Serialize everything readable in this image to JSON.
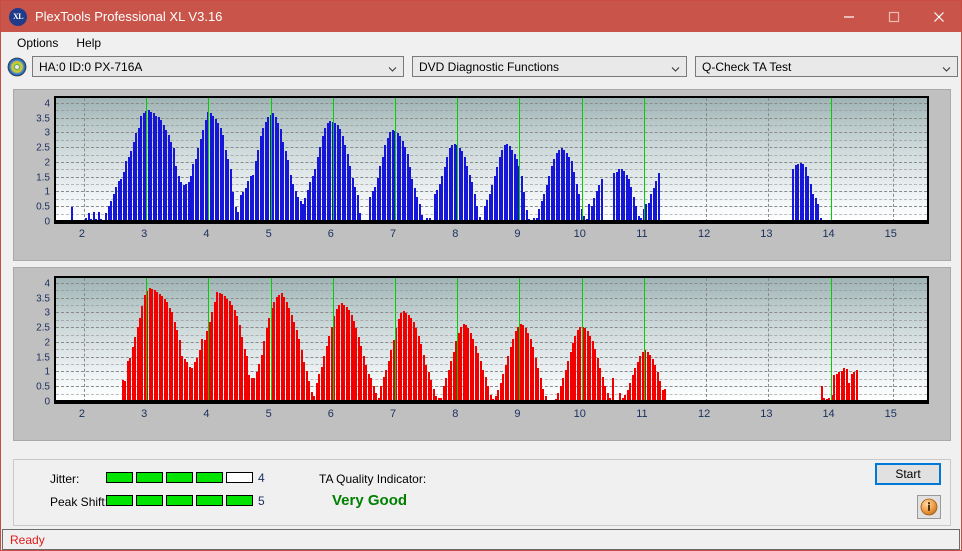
{
  "window": {
    "title": "PlexTools Professional XL V3.16",
    "icon": "app-disc-icon",
    "icon_text": "XL",
    "minimize_label": "Minimize",
    "maximize_label": "Maximize",
    "close_label": "Close",
    "titlebar_color": "#c9554a"
  },
  "menu": {
    "items": [
      {
        "label": "Options"
      },
      {
        "label": "Help"
      }
    ]
  },
  "toolbar": {
    "disc_icon": "optical-disc-icon",
    "drive_select": {
      "value": "HA:0 ID:0  PX-716A"
    },
    "function_select": {
      "value": "DVD Diagnostic Functions"
    },
    "test_select": {
      "value": "Q-Check TA Test"
    }
  },
  "charts": {
    "y_ticks": [
      "4",
      "3.5",
      "3",
      "2.5",
      "2",
      "1.5",
      "1",
      "0.5",
      "0"
    ],
    "x_ticks": [
      "2",
      "3",
      "4",
      "5",
      "6",
      "7",
      "8",
      "9",
      "10",
      "11",
      "12",
      "13",
      "14",
      "15"
    ],
    "marker_color": "#00d000",
    "markers": [
      3,
      4,
      5,
      6,
      7,
      8,
      9,
      10,
      11,
      14
    ]
  },
  "chart_data": [
    {
      "type": "bar",
      "name": "jitter-histogram-top",
      "title": "",
      "xlabel": "",
      "ylabel": "",
      "color": "#1616d8",
      "xlim": [
        1.55,
        15.55
      ],
      "ylim": [
        0,
        4.2
      ],
      "xticks": [
        2,
        3,
        4,
        5,
        6,
        7,
        8,
        9,
        10,
        11,
        12,
        13,
        14,
        15
      ],
      "yticks": [
        0,
        0.5,
        1,
        1.5,
        2,
        2.5,
        3,
        3.5,
        4
      ],
      "grid": true,
      "x": [
        1.8,
        1.84,
        1.88,
        1.92,
        1.96,
        2.0,
        2.04,
        2.08,
        2.12,
        2.16,
        2.2,
        2.24,
        2.28,
        2.32,
        2.36,
        2.4,
        2.44,
        2.48,
        2.52,
        2.56,
        2.6,
        2.64,
        2.68,
        2.72,
        2.76,
        2.8,
        2.84,
        2.88,
        2.92,
        2.96,
        3.0,
        3.04,
        3.08,
        3.12,
        3.16,
        3.2,
        3.24,
        3.28,
        3.32,
        3.36,
        3.4,
        3.44,
        3.48,
        3.52,
        3.56,
        3.6,
        3.64,
        3.68,
        3.72,
        3.76,
        3.8,
        3.84,
        3.88,
        3.92,
        3.96,
        4.0,
        4.04,
        4.08,
        4.12,
        4.16,
        4.2,
        4.24,
        4.28,
        4.32,
        4.36,
        4.4,
        4.44,
        4.48,
        4.52,
        4.56,
        4.6,
        4.64,
        4.68,
        4.72,
        4.76,
        4.8,
        4.84,
        4.88,
        4.92,
        4.96,
        5.0,
        5.04,
        5.08,
        5.12,
        5.16,
        5.2,
        5.24,
        5.28,
        5.32,
        5.36,
        5.4,
        5.44,
        5.48,
        5.52,
        5.56,
        5.6,
        5.64,
        5.68,
        5.72,
        5.76,
        5.8,
        5.84,
        5.88,
        5.92,
        5.96,
        6.0,
        6.04,
        6.08,
        6.12,
        6.16,
        6.2,
        6.24,
        6.28,
        6.32,
        6.36,
        6.4,
        6.44,
        6.48,
        6.52,
        6.56,
        6.6,
        6.64,
        6.68,
        6.72,
        6.76,
        6.8,
        6.84,
        6.88,
        6.92,
        6.96,
        7.0,
        7.04,
        7.08,
        7.12,
        7.16,
        7.2,
        7.24,
        7.28,
        7.32,
        7.36,
        7.4,
        7.44,
        7.48,
        7.52,
        7.56,
        7.6,
        7.64,
        7.68,
        7.72,
        7.76,
        7.8,
        7.84,
        7.88,
        7.92,
        7.96,
        8.0,
        8.04,
        8.08,
        8.12,
        8.16,
        8.2,
        8.24,
        8.28,
        8.32,
        8.36,
        8.4,
        8.44,
        8.48,
        8.52,
        8.56,
        8.6,
        8.64,
        8.68,
        8.72,
        8.76,
        8.8,
        8.84,
        8.88,
        8.92,
        8.96,
        9.0,
        9.04,
        9.08,
        9.12,
        9.16,
        9.2,
        9.24,
        9.28,
        9.32,
        9.36,
        9.4,
        9.44,
        9.48,
        9.52,
        9.56,
        9.6,
        9.64,
        9.68,
        9.72,
        9.76,
        9.8,
        9.84,
        9.88,
        9.92,
        9.96,
        10.0,
        10.04,
        10.08,
        10.12,
        10.16,
        10.2,
        10.24,
        10.28,
        10.32,
        10.52,
        10.56,
        10.6,
        10.64,
        10.68,
        10.72,
        10.76,
        10.8,
        10.84,
        10.88,
        10.92,
        10.96,
        11.0,
        11.04,
        11.08,
        11.12,
        11.16,
        11.2,
        11.24,
        13.4,
        13.44,
        13.48,
        13.52,
        13.56,
        13.6,
        13.64,
        13.68,
        13.72,
        13.76,
        13.8,
        13.84,
        13.88,
        13.92,
        13.96,
        14.0,
        14.04,
        14.08,
        14.12,
        14.16,
        14.2,
        14.24
      ],
      "values": [
        0.5,
        0.02,
        0.02,
        0.02,
        0.02,
        0.02,
        0.12,
        0.3,
        0.1,
        0.33,
        0.1,
        0.33,
        0.1,
        0.04,
        0.3,
        0.55,
        0.7,
        0.95,
        1.2,
        1.4,
        1.45,
        1.7,
        2.05,
        2.2,
        2.4,
        2.7,
        3.0,
        3.2,
        3.6,
        3.7,
        3.75,
        3.78,
        3.72,
        3.68,
        3.6,
        3.55,
        3.45,
        3.3,
        3.1,
        2.95,
        2.7,
        2.5,
        1.9,
        1.55,
        1.35,
        1.25,
        1.3,
        1.35,
        1.55,
        1.95,
        2.15,
        2.5,
        2.8,
        3.1,
        3.45,
        3.72,
        3.68,
        3.6,
        3.5,
        3.35,
        3.18,
        2.95,
        2.45,
        2.15,
        1.8,
        1.0,
        0.52,
        0.35,
        0.9,
        1.0,
        1.15,
        1.4,
        1.55,
        1.6,
        2.05,
        2.45,
        2.9,
        3.2,
        3.4,
        3.55,
        3.62,
        3.68,
        3.55,
        3.35,
        3.15,
        2.7,
        2.4,
        2.1,
        1.6,
        1.3,
        1.05,
        0.85,
        0.72,
        0.6,
        0.8,
        1.1,
        1.35,
        1.55,
        1.8,
        2.2,
        2.55,
        2.9,
        3.2,
        3.35,
        3.42,
        3.4,
        3.35,
        3.28,
        3.15,
        2.9,
        2.6,
        2.3,
        1.9,
        1.5,
        1.2,
        0.9,
        0.3,
        0.05,
        0.02,
        0.02,
        0.85,
        1.05,
        1.2,
        1.5,
        1.9,
        2.2,
        2.6,
        2.85,
        3.05,
        3.12,
        3.08,
        3.0,
        2.9,
        2.75,
        2.55,
        2.3,
        1.85,
        1.45,
        1.15,
        0.85,
        0.6,
        0.25,
        0.08,
        0.15,
        0.12,
        0.05,
        0.95,
        1.1,
        1.3,
        1.55,
        1.85,
        2.2,
        2.5,
        2.62,
        2.65,
        2.6,
        2.52,
        2.4,
        2.2,
        1.9,
        1.6,
        1.35,
        0.95,
        0.55,
        0.18,
        0.06,
        0.55,
        0.75,
        0.95,
        1.25,
        1.55,
        1.85,
        2.2,
        2.45,
        2.6,
        2.65,
        2.58,
        2.45,
        2.3,
        2.15,
        1.9,
        1.55,
        1.0,
        0.4,
        0.1,
        0.06,
        0.15,
        0.12,
        0.45,
        0.7,
        0.95,
        1.25,
        1.55,
        1.9,
        2.15,
        2.35,
        2.45,
        2.5,
        2.45,
        2.35,
        2.2,
        2.05,
        1.7,
        1.3,
        0.95,
        0.45,
        0.2,
        0.1,
        0.6,
        0.55,
        0.8,
        1.05,
        1.25,
        1.45,
        1.65,
        1.7,
        1.8,
        1.78,
        1.72,
        1.6,
        1.45,
        1.2,
        0.85,
        0.55,
        0.2,
        0.15,
        0.45,
        0.6,
        0.65,
        0.95,
        1.15,
        1.4,
        1.65,
        1.8,
        1.92,
        1.98,
        2.0,
        1.95,
        1.85,
        1.55,
        1.3,
        0.95,
        0.8,
        0.6,
        0.15
      ],
      "bar_count": 263
    },
    {
      "type": "bar",
      "name": "peak-shift-histogram-bottom",
      "title": "",
      "xlabel": "",
      "ylabel": "",
      "color": "#f20000",
      "xlim": [
        1.55,
        15.55
      ],
      "ylim": [
        0,
        4.2
      ],
      "xticks": [
        2,
        3,
        4,
        5,
        6,
        7,
        8,
        9,
        10,
        11,
        12,
        13,
        14,
        15
      ],
      "yticks": [
        0,
        0.5,
        1,
        1.5,
        2,
        2.5,
        3,
        3.5,
        4
      ],
      "grid": true,
      "x": [
        2.62,
        2.66,
        2.7,
        2.74,
        2.78,
        2.82,
        2.86,
        2.9,
        2.94,
        2.98,
        3.02,
        3.06,
        3.1,
        3.14,
        3.18,
        3.22,
        3.26,
        3.3,
        3.34,
        3.38,
        3.42,
        3.46,
        3.5,
        3.54,
        3.58,
        3.62,
        3.66,
        3.7,
        3.74,
        3.78,
        3.82,
        3.86,
        3.9,
        3.94,
        3.98,
        4.02,
        4.06,
        4.1,
        4.14,
        4.18,
        4.22,
        4.26,
        4.3,
        4.34,
        4.38,
        4.42,
        4.46,
        4.5,
        4.54,
        4.58,
        4.62,
        4.66,
        4.7,
        4.74,
        4.78,
        4.82,
        4.86,
        4.9,
        4.94,
        4.98,
        5.02,
        5.06,
        5.1,
        5.14,
        5.18,
        5.22,
        5.26,
        5.3,
        5.34,
        5.38,
        5.42,
        5.46,
        5.5,
        5.54,
        5.58,
        5.62,
        5.66,
        5.7,
        5.74,
        5.78,
        5.82,
        5.86,
        5.9,
        5.94,
        5.98,
        6.02,
        6.06,
        6.1,
        6.14,
        6.18,
        6.22,
        6.26,
        6.3,
        6.34,
        6.38,
        6.42,
        6.46,
        6.5,
        6.54,
        6.58,
        6.62,
        6.66,
        6.7,
        6.74,
        6.78,
        6.82,
        6.86,
        6.9,
        6.94,
        6.98,
        7.02,
        7.06,
        7.1,
        7.14,
        7.18,
        7.22,
        7.26,
        7.3,
        7.34,
        7.38,
        7.42,
        7.46,
        7.5,
        7.54,
        7.58,
        7.62,
        7.66,
        7.7,
        7.74,
        7.78,
        7.82,
        7.86,
        7.9,
        7.94,
        7.98,
        8.02,
        8.06,
        8.1,
        8.14,
        8.18,
        8.22,
        8.26,
        8.3,
        8.34,
        8.38,
        8.42,
        8.46,
        8.5,
        8.54,
        8.58,
        8.62,
        8.66,
        8.7,
        8.74,
        8.78,
        8.82,
        8.86,
        8.9,
        8.94,
        8.98,
        9.02,
        9.06,
        9.1,
        9.14,
        9.18,
        9.22,
        9.26,
        9.3,
        9.34,
        9.38,
        9.42,
        9.58,
        9.62,
        9.66,
        9.7,
        9.74,
        9.78,
        9.82,
        9.86,
        9.9,
        9.94,
        9.98,
        10.02,
        10.06,
        10.1,
        10.14,
        10.18,
        10.22,
        10.26,
        10.3,
        10.34,
        10.38,
        10.42,
        10.46,
        10.5,
        10.62,
        10.66,
        10.7,
        10.74,
        10.78,
        10.82,
        10.86,
        10.9,
        10.94,
        10.98,
        11.02,
        11.06,
        11.1,
        11.14,
        11.18,
        11.22,
        11.26,
        11.3,
        11.34,
        13.86,
        13.9,
        13.94,
        13.98,
        14.02,
        14.06,
        14.1,
        14.14,
        14.18,
        14.22,
        14.26,
        14.3,
        14.34,
        14.38,
        14.42
      ],
      "values": [
        0.75,
        0.7,
        1.4,
        1.5,
        1.85,
        2.2,
        2.55,
        2.85,
        3.25,
        3.62,
        3.75,
        3.85,
        3.82,
        3.78,
        3.72,
        3.65,
        3.58,
        3.5,
        3.38,
        3.2,
        3.05,
        2.7,
        2.45,
        2.1,
        1.55,
        1.45,
        1.35,
        1.2,
        1.15,
        1.35,
        1.5,
        1.75,
        2.15,
        2.1,
        2.4,
        2.7,
        3.05,
        3.4,
        3.72,
        3.7,
        3.65,
        3.58,
        3.5,
        3.42,
        3.3,
        3.1,
        2.9,
        2.6,
        2.2,
        1.8,
        1.55,
        0.9,
        0.8,
        0.8,
        1.0,
        1.3,
        1.6,
        2.05,
        2.5,
        2.85,
        3.2,
        3.4,
        3.55,
        3.62,
        3.68,
        3.55,
        3.4,
        3.2,
        2.95,
        2.7,
        2.45,
        2.15,
        1.75,
        1.35,
        1.05,
        0.7,
        0.35,
        0.2,
        0.65,
        0.95,
        1.2,
        1.55,
        1.9,
        2.25,
        2.55,
        2.9,
        3.15,
        3.3,
        3.35,
        3.3,
        3.22,
        3.1,
        2.95,
        2.75,
        2.5,
        2.2,
        1.9,
        1.55,
        1.25,
        0.95,
        0.8,
        0.55,
        0.3,
        0.15,
        0.55,
        0.85,
        1.1,
        1.4,
        1.75,
        2.1,
        2.5,
        2.8,
        3.0,
        3.08,
        3.02,
        2.95,
        2.85,
        2.7,
        2.5,
        2.25,
        1.95,
        1.6,
        1.25,
        1.0,
        0.75,
        0.45,
        0.2,
        0.12,
        0.15,
        0.55,
        0.8,
        1.1,
        1.4,
        1.7,
        2.05,
        2.35,
        2.55,
        2.65,
        2.6,
        2.5,
        2.35,
        2.15,
        1.9,
        1.65,
        1.4,
        1.1,
        0.85,
        0.55,
        0.25,
        0.1,
        0.2,
        0.4,
        0.65,
        0.95,
        1.25,
        1.55,
        1.85,
        2.15,
        2.4,
        2.55,
        2.65,
        2.6,
        2.5,
        2.35,
        2.15,
        1.85,
        1.5,
        1.15,
        0.8,
        0.45,
        0.2,
        0.1,
        0.3,
        0.55,
        0.8,
        1.1,
        1.4,
        1.7,
        2.0,
        2.25,
        2.45,
        2.55,
        2.55,
        2.5,
        2.4,
        2.25,
        2.05,
        1.8,
        1.5,
        1.15,
        0.85,
        0.55,
        0.3,
        0.15,
        0.8,
        0.3,
        0.15,
        0.25,
        0.4,
        0.65,
        0.9,
        1.15,
        1.35,
        1.55,
        1.7,
        1.75,
        1.7,
        1.6,
        1.45,
        1.25,
        1.0,
        0.7,
        0.4,
        0.45,
        0.55,
        0.15,
        0.1,
        0.15,
        0.25,
        0.9,
        0.95,
        1.0,
        1.05,
        1.15,
        1.12,
        0.65,
        0.95,
        1.0,
        1.08,
        0.6,
        0.95,
        0.15
      ]
    }
  ],
  "results": {
    "jitter": {
      "label": "Jitter:",
      "value": "4",
      "segments": [
        true,
        true,
        true,
        true,
        false
      ]
    },
    "peak_shift": {
      "label": "Peak Shift:",
      "value": "5",
      "segments": [
        true,
        true,
        true,
        true,
        true
      ]
    },
    "ta_quality": {
      "label": "TA Quality Indicator:",
      "value": "Very Good",
      "color": "#008000"
    },
    "start_button": "Start",
    "info_button": "info-icon"
  },
  "statusbar": {
    "text": "Ready",
    "color": "#e01b1b"
  }
}
